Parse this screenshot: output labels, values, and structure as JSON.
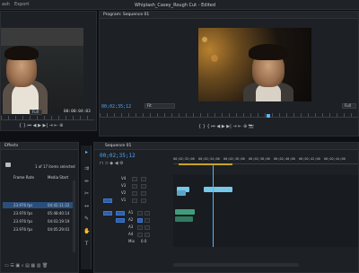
{
  "app": {
    "document_title": "Whiplash_Casey_Rough Cut - Edited",
    "menu": [
      "ash",
      "Export"
    ]
  },
  "source_monitor": {
    "zoom": "Full",
    "timecode": "00:00:04:03"
  },
  "program_monitor": {
    "title": "Program: Sequence 01",
    "timecode": "00;02;35;12",
    "fit": "Fit",
    "zoom": "Full"
  },
  "project_panel": {
    "title": "Effects",
    "selection_count": "1 of 17 items selected",
    "columns": [
      "Frame Rate",
      "Media Start"
    ],
    "rows": [
      {
        "rate": "23.976 fps",
        "start": "04:42:11:22"
      },
      {
        "rate": "23.976 fps",
        "start": "05:48:40:14"
      },
      {
        "rate": "23.976 fps",
        "start": "04:03:19:19"
      },
      {
        "rate": "23.976 fps",
        "start": "04:05:29:01"
      }
    ]
  },
  "timeline": {
    "title": "Sequence 01",
    "timecode": "00;02;35;12",
    "ruler_labels": [
      "00;02;32;00",
      "00;02;34;00",
      "00;02;36;00",
      "00;02;38;00",
      "00;02;40;00",
      "00;02;42;00",
      "00;02;44;00"
    ],
    "video_tracks": [
      "V4",
      "V3",
      "V2",
      "V1"
    ],
    "audio_tracks": [
      "A1",
      "A2",
      "A3",
      "A4"
    ],
    "mix_label": "Mix",
    "mix_value": "0.0"
  },
  "colors": {
    "accent": "#4aa8ff",
    "video_clip": "#78c7e8",
    "audio_clip": "#3f9d7c",
    "playhead": "#57b6ff"
  }
}
